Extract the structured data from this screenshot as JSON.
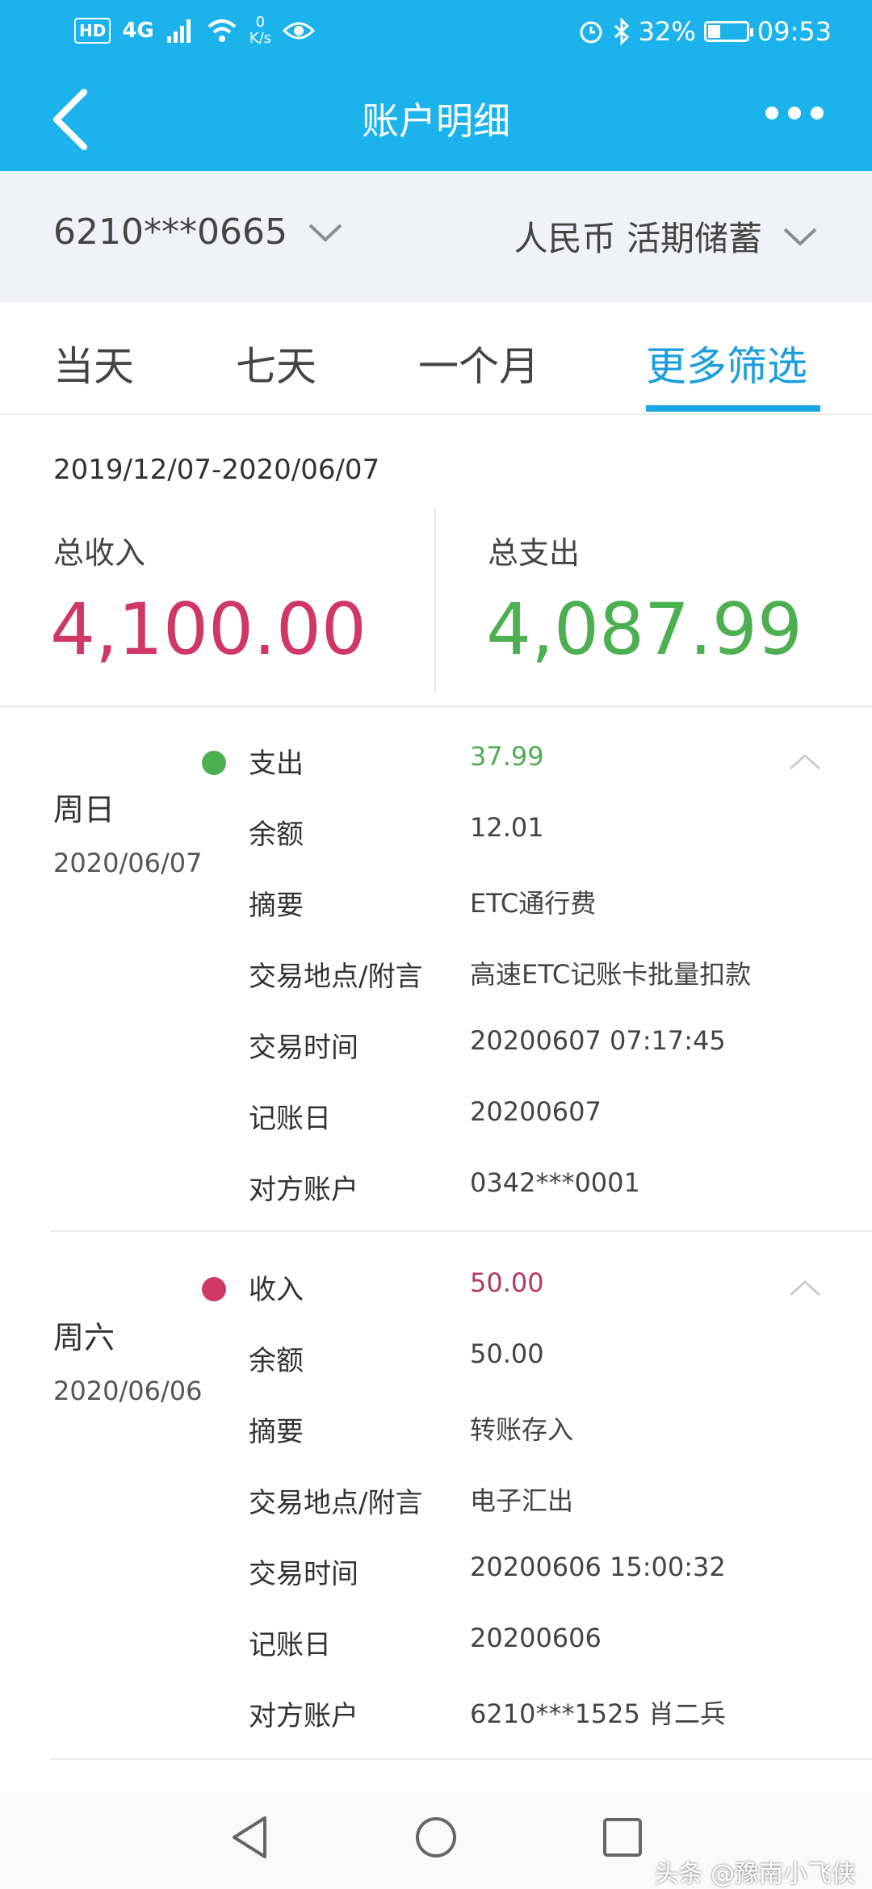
{
  "status_bar": {
    "hd": "HD",
    "signal": "4G",
    "speed_value": "0",
    "speed_unit": "K/s",
    "battery": "32%",
    "battery_level": 0.32,
    "time": "09:53"
  },
  "header": {
    "title": "账户明细"
  },
  "account_bar": {
    "account": "6210***0665",
    "currency_type": "人民币 活期储蓄"
  },
  "tabs": [
    {
      "label": "当天"
    },
    {
      "label": "七天"
    },
    {
      "label": "一个月"
    },
    {
      "label": "更多筛选"
    }
  ],
  "active_tab": "更多筛选",
  "summary": {
    "date_range": "2019/12/07-2020/06/07",
    "income_label": "总收入",
    "income_value": "4,100.00",
    "expense_label": "总支出",
    "expense_value": "4,087.99"
  },
  "transactions": [
    {
      "weekday": "周日",
      "date": "2020/06/07",
      "type_label": "支出",
      "amount": "37.99",
      "rows": [
        {
          "label": "余额",
          "value": "12.01"
        },
        {
          "label": "摘要",
          "value": "ETC通行费"
        },
        {
          "label": "交易地点/附言",
          "value": "高速ETC记账卡批量扣款"
        },
        {
          "label": "交易时间",
          "value": "20200607 07:17:45"
        },
        {
          "label": "记账日",
          "value": "20200607"
        },
        {
          "label": "对方账户",
          "value": "0342***0001"
        }
      ]
    },
    {
      "weekday": "周六",
      "date": "2020/06/06",
      "type_label": "收入",
      "amount": "50.00",
      "rows": [
        {
          "label": "余额",
          "value": "50.00"
        },
        {
          "label": "摘要",
          "value": "转账存入"
        },
        {
          "label": "交易地点/附言",
          "value": "电子汇出"
        },
        {
          "label": "交易时间",
          "value": "20200606 15:00:32"
        },
        {
          "label": "记账日",
          "value": "20200606"
        },
        {
          "label": "对方账户",
          "value": "6210***1525 肖二兵"
        }
      ]
    }
  ],
  "watermark": "头条 @豫南小飞侠",
  "colors": {
    "primary": "#1cb3ec",
    "income": "#cf3865",
    "expense": "#4caf50",
    "active_tab": "#1a9fdc"
  },
  "icons": [
    "back-arrow-icon",
    "more-dots-icon",
    "chevron-down-icon",
    "collapse-arrow-icon",
    "nav-back-icon",
    "nav-home-icon",
    "nav-recent-icon"
  ]
}
